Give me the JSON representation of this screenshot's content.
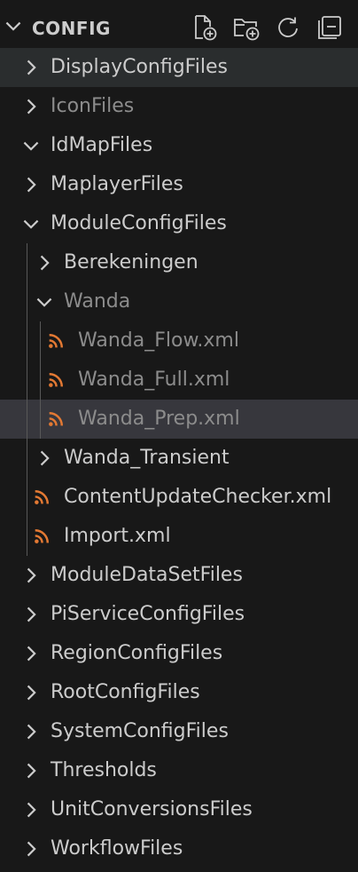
{
  "explorer": {
    "section_title": "CONFIG",
    "actions": {
      "new_file": "new-file-icon",
      "new_folder": "new-folder-icon",
      "refresh": "refresh-icon",
      "collapse_all": "collapse-all-icon"
    },
    "colors": {
      "background": "#181818",
      "text": "#cccccc",
      "dim_text": "#8c8c8c",
      "hover_row": "#2a2d2e",
      "selected_row": "#37373d",
      "rss_icon": "#e37933"
    }
  },
  "tree": {
    "items": [
      {
        "label": "DisplayConfigFiles",
        "type": "folder",
        "expanded": false,
        "depth": 0,
        "dim": false,
        "hover": true
      },
      {
        "label": "IconFiles",
        "type": "folder",
        "expanded": false,
        "depth": 0,
        "dim": true
      },
      {
        "label": "IdMapFiles",
        "type": "folder",
        "expanded": true,
        "depth": 0,
        "dim": false
      },
      {
        "label": "MaplayerFiles",
        "type": "folder",
        "expanded": false,
        "depth": 0,
        "dim": false
      },
      {
        "label": "ModuleConfigFiles",
        "type": "folder",
        "expanded": true,
        "depth": 0,
        "dim": false
      },
      {
        "label": "Berekeningen",
        "type": "folder",
        "expanded": false,
        "depth": 1,
        "dim": false
      },
      {
        "label": "Wanda",
        "type": "folder",
        "expanded": true,
        "depth": 1,
        "dim": true
      },
      {
        "label": "Wanda_Flow.xml",
        "type": "file",
        "icon": "rss-icon",
        "depth": 2,
        "dim": true
      },
      {
        "label": "Wanda_Full.xml",
        "type": "file",
        "icon": "rss-icon",
        "depth": 2,
        "dim": true
      },
      {
        "label": "Wanda_Prep.xml",
        "type": "file",
        "icon": "rss-icon",
        "depth": 2,
        "dim": true,
        "selected": true
      },
      {
        "label": "Wanda_Transient",
        "type": "folder",
        "expanded": false,
        "depth": 1,
        "dim": false
      },
      {
        "label": "ContentUpdateChecker.xml",
        "type": "file",
        "icon": "rss-icon",
        "depth": 1,
        "dim": false
      },
      {
        "label": "Import.xml",
        "type": "file",
        "icon": "rss-icon",
        "depth": 1,
        "dim": false
      },
      {
        "label": "ModuleDataSetFiles",
        "type": "folder",
        "expanded": false,
        "depth": 0,
        "dim": false
      },
      {
        "label": "PiServiceConfigFiles",
        "type": "folder",
        "expanded": false,
        "depth": 0,
        "dim": false
      },
      {
        "label": "RegionConfigFiles",
        "type": "folder",
        "expanded": false,
        "depth": 0,
        "dim": false
      },
      {
        "label": "RootConfigFiles",
        "type": "folder",
        "expanded": false,
        "depth": 0,
        "dim": false
      },
      {
        "label": "SystemConfigFiles",
        "type": "folder",
        "expanded": false,
        "depth": 0,
        "dim": false
      },
      {
        "label": "Thresholds",
        "type": "folder",
        "expanded": false,
        "depth": 0,
        "dim": false
      },
      {
        "label": "UnitConversionsFiles",
        "type": "folder",
        "expanded": false,
        "depth": 0,
        "dim": false
      },
      {
        "label": "WorkflowFiles",
        "type": "folder",
        "expanded": false,
        "depth": 0,
        "dim": false
      }
    ]
  }
}
